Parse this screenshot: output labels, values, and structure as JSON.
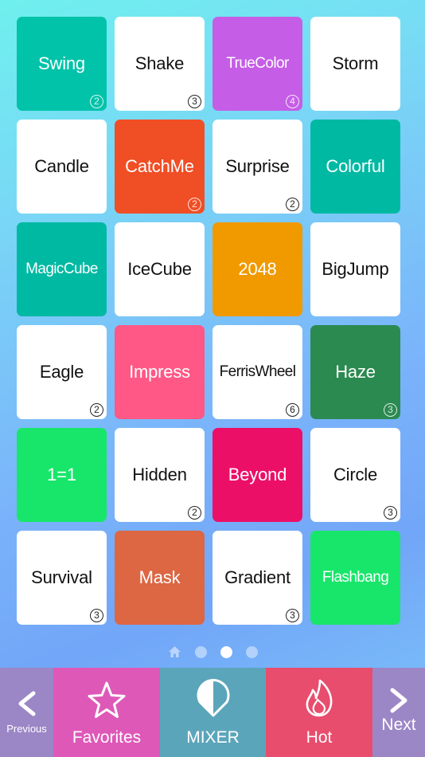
{
  "tiles": [
    {
      "label": "Swing",
      "badge": "2",
      "bg": "#00c3a9",
      "theme": "dark"
    },
    {
      "label": "Shake",
      "badge": "3",
      "bg": "#ffffff",
      "theme": "light"
    },
    {
      "label": "TrueColor",
      "badge": "4",
      "bg": "#c55de6",
      "theme": "dark"
    },
    {
      "label": "Storm",
      "badge": "",
      "bg": "#ffffff",
      "theme": "light"
    },
    {
      "label": "Candle",
      "badge": "",
      "bg": "#ffffff",
      "theme": "light"
    },
    {
      "label": "CatchMe",
      "badge": "2",
      "bg": "#f04e25",
      "theme": "dark"
    },
    {
      "label": "Surprise",
      "badge": "2",
      "bg": "#ffffff",
      "theme": "light"
    },
    {
      "label": "Colorful",
      "badge": "",
      "bg": "#00b9a2",
      "theme": "dark"
    },
    {
      "label": "MagicCube",
      "badge": "",
      "bg": "#00b9a2",
      "theme": "dark"
    },
    {
      "label": "IceCube",
      "badge": "",
      "bg": "#ffffff",
      "theme": "light"
    },
    {
      "label": "2048",
      "badge": "",
      "bg": "#f09a00",
      "theme": "dark"
    },
    {
      "label": "BigJump",
      "badge": "",
      "bg": "#ffffff",
      "theme": "light"
    },
    {
      "label": "Eagle",
      "badge": "2",
      "bg": "#ffffff",
      "theme": "light"
    },
    {
      "label": "Impress",
      "badge": "",
      "bg": "#ff5886",
      "theme": "dark"
    },
    {
      "label": "FerrisWheel",
      "badge": "6",
      "bg": "#ffffff",
      "theme": "light"
    },
    {
      "label": "Haze",
      "badge": "3",
      "bg": "#2b8a50",
      "theme": "dark"
    },
    {
      "label": "1=1",
      "badge": "",
      "bg": "#18e66a",
      "theme": "dark"
    },
    {
      "label": "Hidden",
      "badge": "2",
      "bg": "#ffffff",
      "theme": "light"
    },
    {
      "label": "Beyond",
      "badge": "",
      "bg": "#ec0f68",
      "theme": "dark"
    },
    {
      "label": "Circle",
      "badge": "3",
      "bg": "#ffffff",
      "theme": "light"
    },
    {
      "label": "Survival",
      "badge": "3",
      "bg": "#ffffff",
      "theme": "light"
    },
    {
      "label": "Mask",
      "badge": "",
      "bg": "#dd6643",
      "theme": "dark"
    },
    {
      "label": "Gradient",
      "badge": "3",
      "bg": "#ffffff",
      "theme": "light"
    },
    {
      "label": "Flashbang",
      "badge": "",
      "bg": "#18e66a",
      "theme": "dark"
    }
  ],
  "pager": {
    "home_icon": "home-icon",
    "pages": 3,
    "active_page": 2
  },
  "bottom_bar": {
    "previous": {
      "label": "Previous",
      "icon": "chevron-left-icon"
    },
    "favorites": {
      "label": "Favorites",
      "icon": "star-icon"
    },
    "mixer": {
      "label": "MIXER",
      "icon": "half-drop-icon"
    },
    "hot": {
      "label": "Hot",
      "icon": "flame-icon"
    },
    "next": {
      "label": "Next",
      "icon": "chevron-right-icon"
    }
  }
}
